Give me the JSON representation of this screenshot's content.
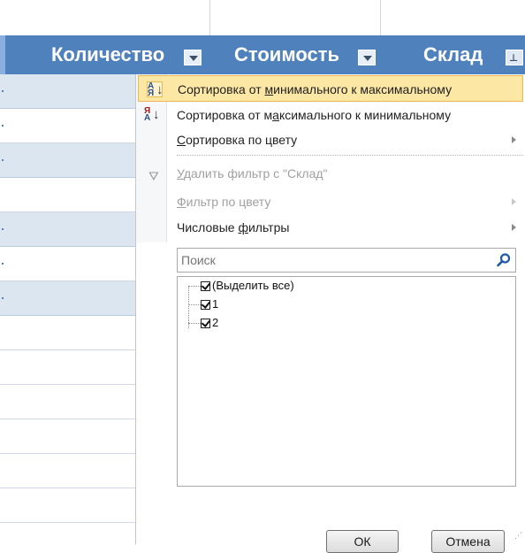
{
  "table_header": {
    "columns": [
      {
        "label": "Количество"
      },
      {
        "label": "Стоимость"
      },
      {
        "label": "Склад"
      }
    ],
    "header_color": "#4f81bd",
    "band_color": "#dce6f1"
  },
  "menu": {
    "items": [
      {
        "label_pre": "Сортировка от ",
        "label_acc": "м",
        "label_post": "инимального к максимальному",
        "icon": "sort-ascending-icon",
        "state": "hover"
      },
      {
        "label_pre": "Сортировка от м",
        "label_acc": "а",
        "label_post": "ксимального к минимальному",
        "icon": "sort-descending-icon",
        "state": "normal"
      },
      {
        "label_pre": "",
        "label_acc": "С",
        "label_post": "ортировка по цвету",
        "state": "normal",
        "submenu": true
      },
      {
        "label_pre": "",
        "label_acc": "У",
        "label_post": "далить фильтр с \"Склад\"",
        "icon": "clear-filter-icon",
        "state": "disabled"
      },
      {
        "label_pre": "",
        "label_acc": "Ф",
        "label_post": "ильтр по цвету",
        "state": "disabled",
        "submenu": true
      },
      {
        "label_pre": "Числовые ",
        "label_acc": "ф",
        "label_post": "ильтры",
        "state": "normal",
        "submenu": true
      }
    ],
    "icons": {
      "ascending_top": "А",
      "ascending_bottom": "Я",
      "descending_top": "Я",
      "descending_bottom": "А",
      "arrow": "↓"
    }
  },
  "search": {
    "placeholder": "Поиск",
    "value": "",
    "icon": "search-icon"
  },
  "values_list": [
    {
      "label": "(Выделить все)",
      "checked": true
    },
    {
      "label": "1",
      "checked": true
    },
    {
      "label": "2",
      "checked": true
    }
  ],
  "buttons": {
    "ok": "ОК",
    "cancel": "Отмена"
  }
}
